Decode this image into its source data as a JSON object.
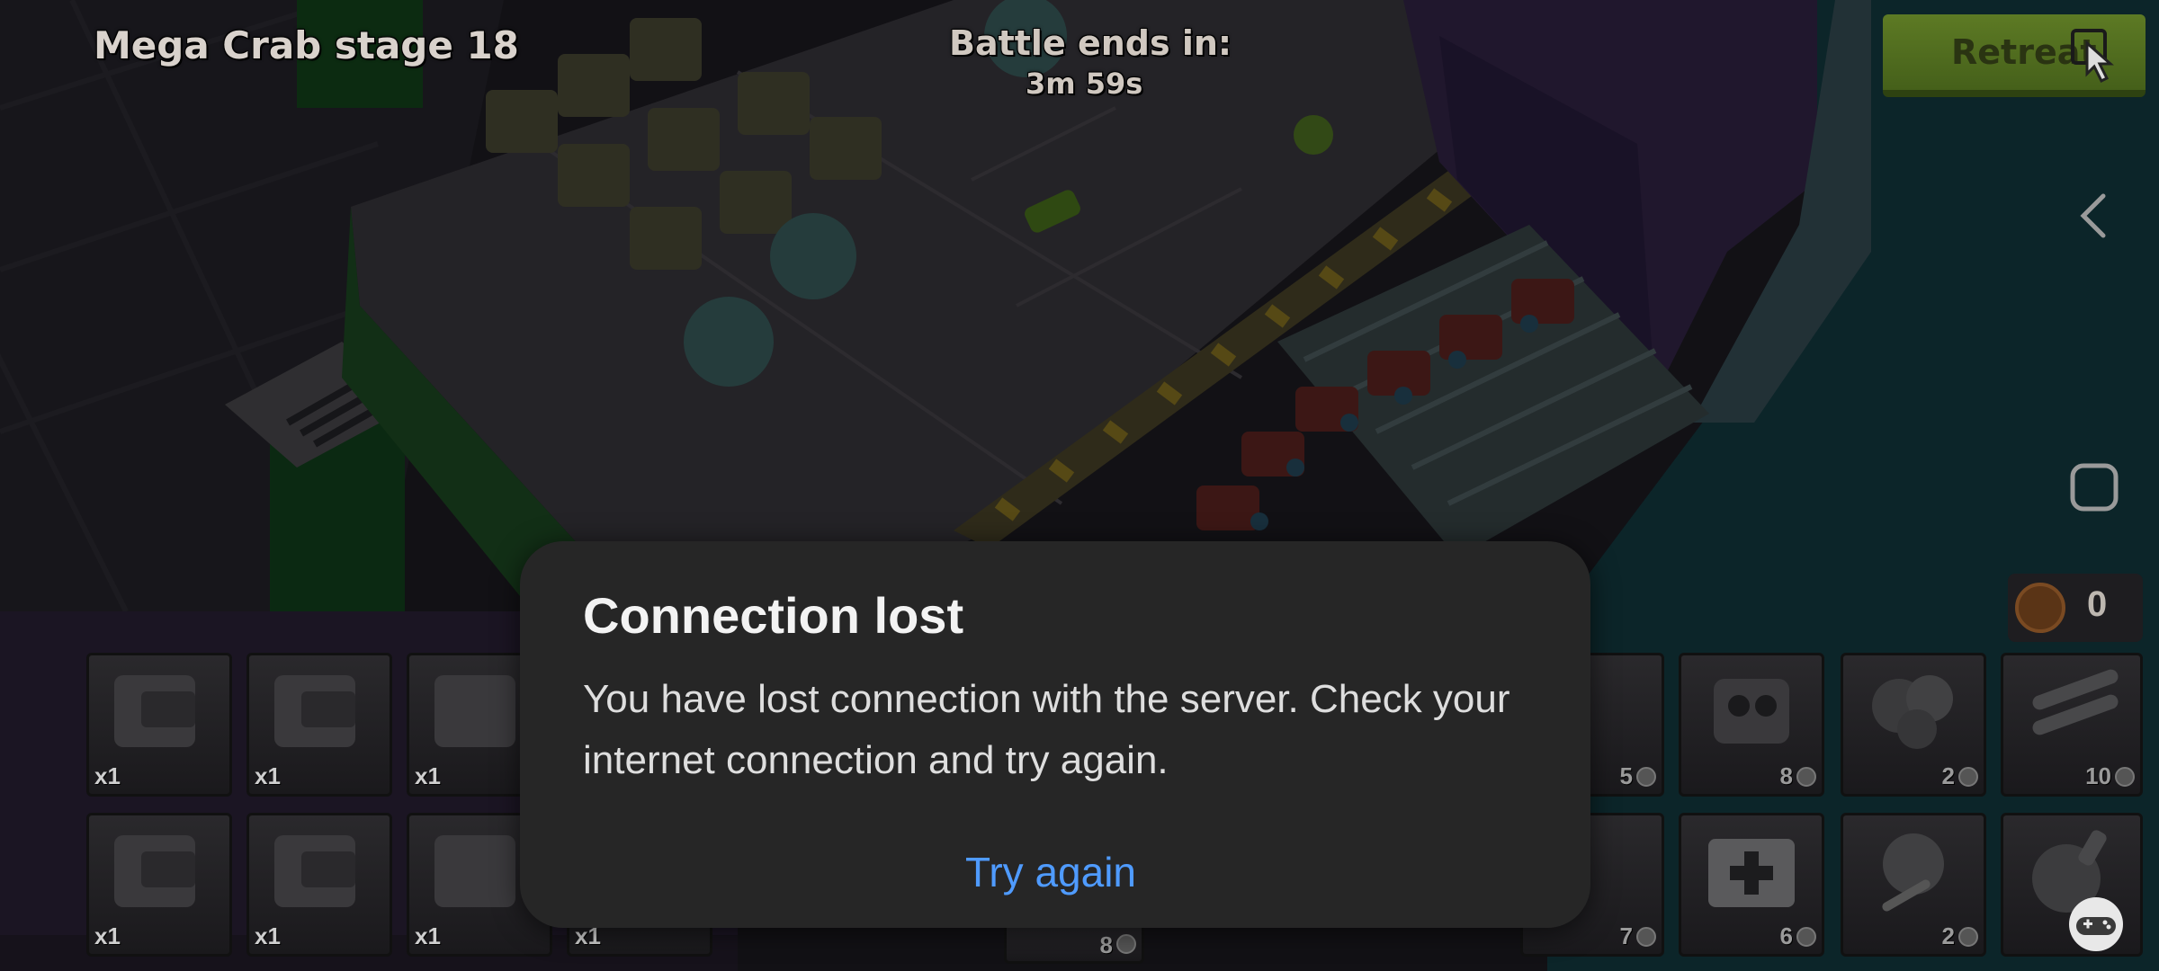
{
  "hud": {
    "stage_title": "Mega Crab stage 18",
    "battle_ends_label": "Battle ends in:",
    "battle_timer": "3m 59s",
    "retreat_label": "Retreat",
    "gold_value": "0"
  },
  "troops_left": [
    {
      "qty": "x1"
    },
    {
      "qty": "x1"
    },
    {
      "qty": "x1"
    },
    {
      "qty": "x1"
    },
    {
      "qty": "x1"
    },
    {
      "qty": "x1"
    },
    {
      "qty": "x1"
    }
  ],
  "partial_card_cost": "8",
  "gunboat_abilities": [
    {
      "name": "flare",
      "cost": "5"
    },
    {
      "name": "shock-bomb",
      "cost": "8"
    },
    {
      "name": "smoke-screen",
      "cost": "2"
    },
    {
      "name": "barrage",
      "cost": "10"
    },
    {
      "name": "artillery",
      "cost": "7"
    },
    {
      "name": "medkit",
      "cost": "6"
    },
    {
      "name": "smoke-flare",
      "cost": "2"
    },
    {
      "name": "critters",
      "cost": ""
    }
  ],
  "dialog": {
    "title": "Connection lost",
    "message": "You have lost connection with the server. Check your internet connection and try again.",
    "action": "Try again"
  },
  "colors": {
    "dialog_bg": "#262626",
    "action_blue": "#4f9bff",
    "retreat_green": "#5d7a24"
  },
  "nav_icons": [
    "back-icon",
    "home-icon",
    "recents-icon"
  ]
}
